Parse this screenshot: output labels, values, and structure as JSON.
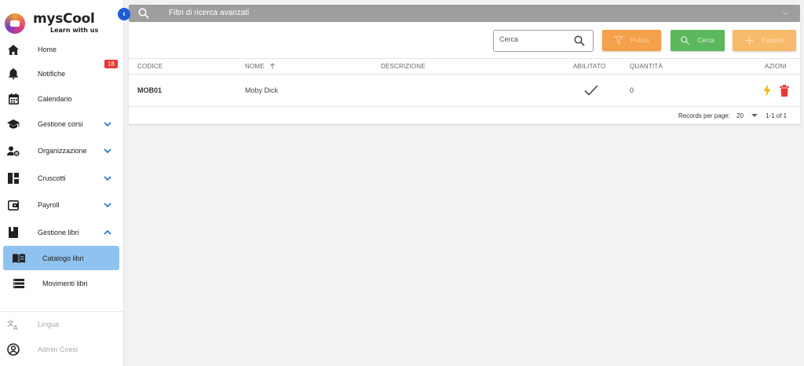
{
  "app": {
    "name": "mysCool",
    "tagline": "Learn with us"
  },
  "sidebar": {
    "items": [
      {
        "label": "Home",
        "icon": "home-icon"
      },
      {
        "label": "Notifiche",
        "icon": "bell-icon",
        "badge": "18"
      },
      {
        "label": "Calendario",
        "icon": "calendar-icon"
      },
      {
        "label": "Gestione corsi",
        "icon": "graduation-cap-icon",
        "expanded": false
      },
      {
        "label": "Organizzazione",
        "icon": "user-settings-icon",
        "expanded": false
      },
      {
        "label": "Cruscotti",
        "icon": "dashboard-icon",
        "expanded": false
      },
      {
        "label": "Payroll",
        "icon": "wallet-icon",
        "expanded": false
      },
      {
        "label": "Gestione libri",
        "icon": "book-icon",
        "expanded": true
      }
    ],
    "sub_items": [
      {
        "label": "Catalogo libri",
        "icon": "open-book-icon",
        "active": true
      },
      {
        "label": "Movimenti libri",
        "icon": "list-icon",
        "active": false
      }
    ],
    "footer": [
      {
        "label": "Lingua",
        "icon": "translate-icon"
      },
      {
        "label": "Admin Coesi",
        "icon": "account-circle-icon"
      }
    ]
  },
  "filter_bar": {
    "title": "Filtri di ricerca avanzati"
  },
  "toolbar": {
    "search_placeholder": "Cerca",
    "clear_label": "Pulisci",
    "search_label": "Cerca",
    "export_label": "Esporta"
  },
  "table": {
    "columns": [
      "CODICE",
      "NOME",
      "DESCRIZIONE",
      "ABILITATO",
      "QUANTITÀ",
      "AZIONI"
    ],
    "sort_column": "NOME",
    "sort_direction": "asc",
    "rows": [
      {
        "codice": "MOB01",
        "nome": "Moby Dick",
        "descrizione": "",
        "abilitato": true,
        "quantita": "0"
      }
    ],
    "footer": {
      "records_label": "Records per page:",
      "per_page": "20",
      "range": "1-1 of 1"
    }
  },
  "colors": {
    "accent": "#1e5bd8",
    "active_item": "#90c2f0",
    "badge": "#e53935",
    "clear_button": "#f5a04a",
    "search_button": "#5cb85c",
    "export_button": "#f7ba6a",
    "bolt": "#f4b400",
    "trash": "#e53935"
  }
}
